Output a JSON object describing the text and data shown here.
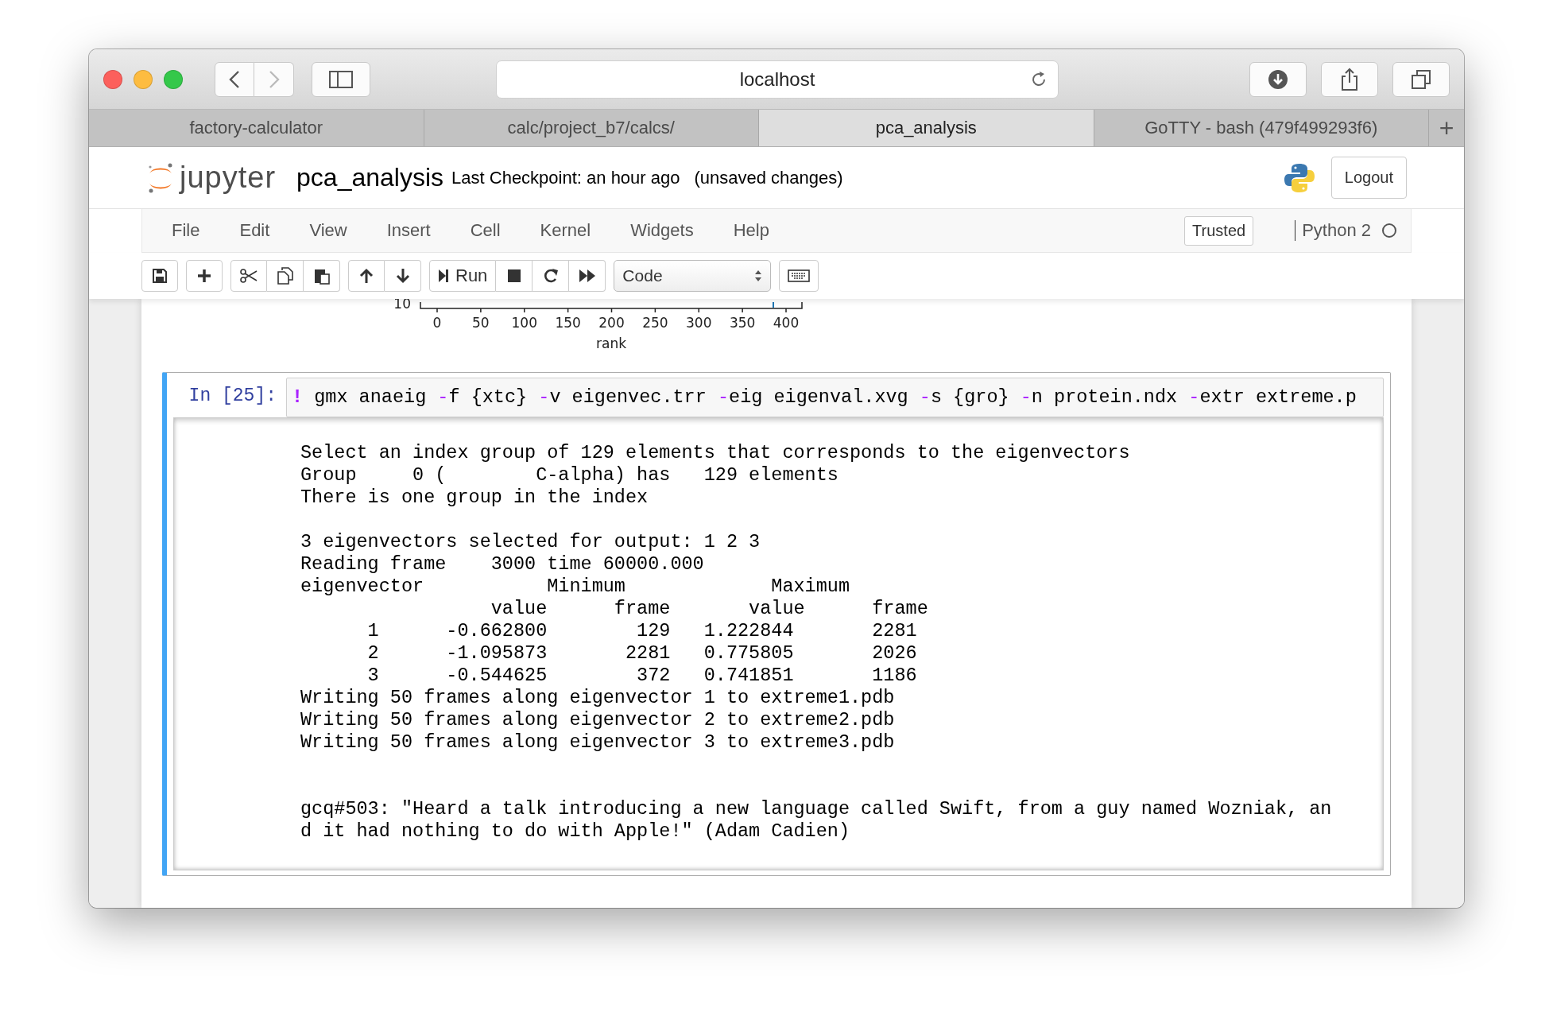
{
  "browser": {
    "address": "localhost",
    "tabs": [
      {
        "label": "factory-calculator",
        "selected": false
      },
      {
        "label": "calc/project_b7/calcs/",
        "selected": false
      },
      {
        "label": "pca_analysis",
        "selected": true
      },
      {
        "label": "GoTTY - bash (479f499293f6)",
        "selected": false
      }
    ],
    "new_tab": "+"
  },
  "header": {
    "logo_text": "jupyter",
    "notebook_name": "pca_analysis",
    "checkpoint": "Last Checkpoint: an hour ago",
    "save_status": "(unsaved changes)",
    "logout": "Logout"
  },
  "menu": {
    "items": [
      "File",
      "Edit",
      "View",
      "Insert",
      "Cell",
      "Kernel",
      "Widgets",
      "Help"
    ],
    "trusted": "Trusted",
    "kernel": "Python 2",
    "kernel_busy": false
  },
  "toolbar": {
    "run": "Run",
    "cell_type": "Code"
  },
  "chart_fragment": {
    "y_tick_label": "10",
    "x_tick_labels": [
      "0",
      "50",
      "100",
      "150",
      "200",
      "250",
      "300",
      "350",
      "400"
    ],
    "x_axis_label": "rank"
  },
  "cell": {
    "prompt": "In [25]:",
    "selected": true,
    "code": [
      {
        "kind": "bang",
        "text": "!"
      },
      {
        "kind": "plain",
        "text": " gmx anaeig "
      },
      {
        "kind": "flag",
        "text": "-"
      },
      {
        "kind": "plain",
        "text": "f {xtc} "
      },
      {
        "kind": "flag",
        "text": "-"
      },
      {
        "kind": "plain",
        "text": "v eigenvec.trr "
      },
      {
        "kind": "flag",
        "text": "-"
      },
      {
        "kind": "plain",
        "text": "eig eigenval.xvg "
      },
      {
        "kind": "flag",
        "text": "-"
      },
      {
        "kind": "plain",
        "text": "s {gro} "
      },
      {
        "kind": "flag",
        "text": "-"
      },
      {
        "kind": "plain",
        "text": "n protein.ndx "
      },
      {
        "kind": "flag",
        "text": "-"
      },
      {
        "kind": "plain",
        "text": "extr extreme.p"
      }
    ],
    "output": [
      {
        "kind": "log",
        "lines": [
          "Select an index group of 129 elements that corresponds to the eigenvectors",
          "Group     0 (        C-alpha) has   129 elements",
          "There is one group in the index"
        ]
      },
      {
        "kind": "log",
        "lines": [
          "3 eigenvectors selected for output: 1 2 3",
          "Reading frame    3000 time 60000.000",
          "eigenvector           Minimum             Maximum",
          "                 value      frame       value      frame",
          "      1      -0.662800        129   1.222844       2281",
          "      2      -1.095873       2281   0.775805       2026",
          "      3      -0.544625        372   0.741851       1186",
          "Writing 50 frames along eigenvector 1 to extreme1.pdb",
          "Writing 50 frames along eigenvector 2 to extreme2.pdb",
          "Writing 50 frames along eigenvector 3 to extreme3.pdb"
        ]
      },
      {
        "kind": "quote",
        "lines": [
          "gcq#503: \"Heard a talk introducing a new language called Swift, from a guy named Wozniak, an",
          "d it had nothing to do with Apple!\" (Adam Cadien)"
        ]
      }
    ]
  }
}
